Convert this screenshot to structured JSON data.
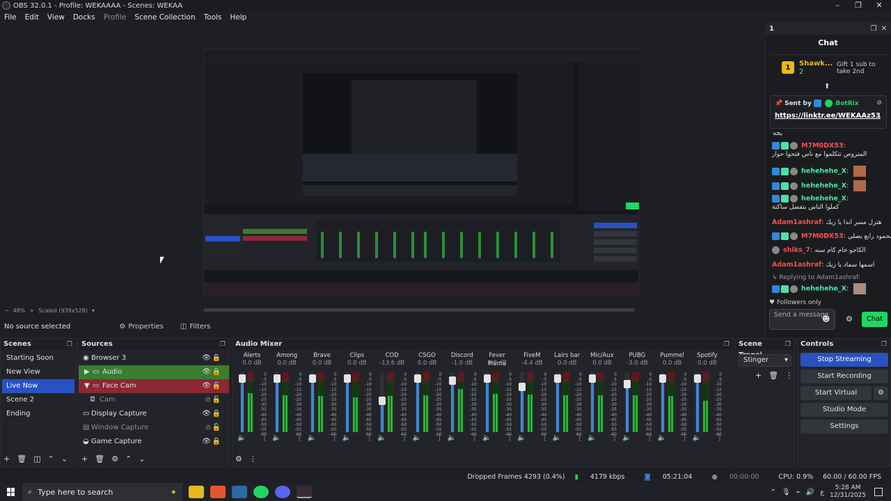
{
  "window": {
    "title": "OBS 32.0.1 - Profile: WEKAAAA - Scenes: WEKAA"
  },
  "menu": [
    "File",
    "Edit",
    "View",
    "Docks",
    "Profile",
    "Scene Collection",
    "Tools",
    "Help"
  ],
  "preview": {
    "zoom": "48%",
    "scale_label": "Scaled (939x528)"
  },
  "source_bar": {
    "no_source": "No source selected",
    "properties": "Properties",
    "filters": "Filters"
  },
  "chat": {
    "tab_label": "1",
    "title": "Chat",
    "top_gifter": {
      "name": "Shawk...",
      "count": "2",
      "gift_text": "Gift 1 sub to take 2nd"
    },
    "pinned": {
      "sent_by": "Sent by",
      "bot": "BotRix",
      "link": "https://linktr.ee/WEKAAz53"
    },
    "messages": [
      {
        "user": "",
        "text": "يجه",
        "color": "#e3e3e3"
      },
      {
        "user": "M7M0DX53",
        "text": "المتروص تتكلموا مع ناس فتحوا حوار",
        "color": "#ff4d4d"
      },
      {
        "user": "hehehehe_X",
        "text": "",
        "color": "#49e4a3"
      },
      {
        "user": "hehehehe_X",
        "text": "",
        "color": "#49e4a3"
      },
      {
        "user": "hehehehe_X",
        "text": "كملوا الناس بتفضل ساكتة",
        "color": "#49e4a3"
      },
      {
        "user": "Adam1ashraf",
        "text": "هتزل مسر اندا يا زيك",
        "color": "#ff4d4d"
      },
      {
        "user": "M7M0DX53",
        "text": "محمود رابع يصلي",
        "color": "#ff4d4d"
      },
      {
        "user": "shiks_7",
        "text": "الكاجو خام كام سنه",
        "color": "#ff4d4d"
      },
      {
        "user": "Adam1ashraf",
        "text": "اسمها سماد يا زيك",
        "color": "#ff4d4d"
      },
      {
        "user": "",
        "text": "Replying to Adam1ashraf:",
        "color": "#999"
      },
      {
        "user": "hehehehe_X",
        "text": "",
        "color": "#49e4a3"
      }
    ],
    "followers_only": "Followers only",
    "input_placeholder": "Send a message",
    "send_label": "Chat"
  },
  "docks": {
    "scenes": {
      "title": "Scenes",
      "items": [
        "Starting Soon",
        "New View",
        "Live Now",
        "Scene 2",
        "Ending"
      ],
      "selected": 2
    },
    "sources": {
      "title": "Sources",
      "items": [
        {
          "label": "Browser 3",
          "icon": "globe-icon",
          "state": "normal"
        },
        {
          "label": "Audio",
          "icon": "folder-icon",
          "state": "green"
        },
        {
          "label": "Face Cam",
          "icon": "folder-icon",
          "state": "red"
        },
        {
          "label": "Cam",
          "icon": "camera-icon",
          "state": "dim"
        },
        {
          "label": "Display Capture",
          "icon": "monitor-icon",
          "state": "normal"
        },
        {
          "label": "Window Capture",
          "icon": "window-icon",
          "state": "dim"
        },
        {
          "label": "Game Capture",
          "icon": "gamepad-icon",
          "state": "normal"
        }
      ]
    },
    "mixer": {
      "title": "Audio Mixer",
      "channels": [
        {
          "name": "Alerts",
          "db": "0.0 dB",
          "level": 0.78,
          "fader": 0.92
        },
        {
          "name": "Among",
          "db": "0.0 dB",
          "level": 0.74,
          "fader": 0.92
        },
        {
          "name": "Brave",
          "db": "0.0 dB",
          "level": 0.72,
          "fader": 0.92
        },
        {
          "name": "Clips",
          "db": "0.0 dB",
          "level": 0.7,
          "fader": 0.92
        },
        {
          "name": "COD",
          "db": "-13.6 dB",
          "level": 0.72,
          "fader": 0.55
        },
        {
          "name": "CSGO",
          "db": "0.0 dB",
          "level": 0.74,
          "fader": 0.92
        },
        {
          "name": "Discord",
          "db": "-1.0 dB",
          "level": 0.86,
          "fader": 0.88
        },
        {
          "name": "Fever Meme",
          "db": "0.0 dB",
          "level": 0.76,
          "fader": 0.92
        },
        {
          "name": "FiveM",
          "db": "-4.4 dB",
          "level": 0.75,
          "fader": 0.78
        },
        {
          "name": "Lairs bar",
          "db": "0.0 dB",
          "level": 0.73,
          "fader": 0.92
        },
        {
          "name": "Mic/Aux",
          "db": "0.0 dB",
          "level": 0.74,
          "fader": 0.92
        },
        {
          "name": "PUBG",
          "db": "-3.0 dB",
          "level": 0.74,
          "fader": 0.82
        },
        {
          "name": "Pummel",
          "db": "0.0 dB",
          "level": 0.72,
          "fader": 0.92
        },
        {
          "name": "Spotify",
          "db": "0.0 dB",
          "level": 0.62,
          "fader": 0.92
        }
      ]
    },
    "transitions": {
      "title": "Scene Transi...",
      "selected": "Stinger"
    },
    "controls": {
      "title": "Controls",
      "buttons": [
        "Stop Streaming",
        "Start Recording",
        "Start Virtual Camera",
        "Studio Mode",
        "Settings"
      ]
    }
  },
  "status": {
    "dropped": "Dropped Frames 4293 (0.4%)",
    "bitrate": "4179 kbps",
    "stream_time": "05:21:04",
    "rec_time": "00:00:00",
    "cpu": "CPU: 0.9%",
    "fps": "60.00 / 60.00 FPS"
  },
  "taskbar": {
    "search_placeholder": "Type here to search",
    "lang": "ع",
    "time": "5:28 AM",
    "date": "12/31/2025"
  }
}
